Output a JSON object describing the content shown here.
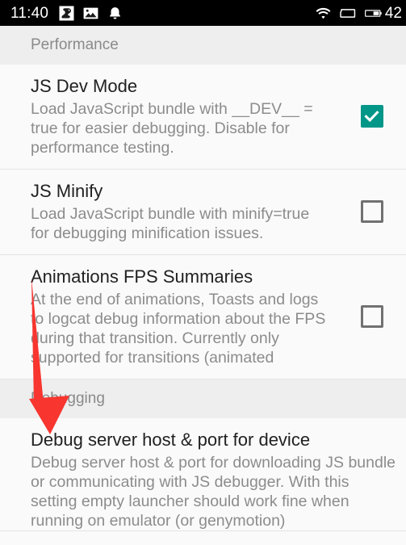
{
  "status_bar": {
    "time": "11:40",
    "battery_percent": "42",
    "left_icons": [
      "app-squirrel-icon",
      "screenshot-image-icon",
      "notification-bell-icon"
    ],
    "right_icons": [
      "wifi-icon",
      "sim-card-icon",
      "battery-icon"
    ],
    "background_color": "#000000",
    "text_color": "#ffffff"
  },
  "colors": {
    "accent_checked": "#009688",
    "section_header_bg": "#eeeeee",
    "page_bg": "#fafafa",
    "title_text": "#212121",
    "summary_text": "#8c8c8c",
    "divider": "#e4e4e4",
    "annotation_arrow": "#f8352f"
  },
  "sections": [
    {
      "header": "Performance",
      "rows": [
        {
          "title": "JS Dev Mode",
          "summary": "Load JavaScript bundle with __DEV__ = true for easier debugging.  Disable for performance testing.",
          "control": "checkbox",
          "checked": true
        },
        {
          "title": "JS Minify",
          "summary": "Load JavaScript bundle with minify=true for debugging minification issues.",
          "control": "checkbox",
          "checked": false
        },
        {
          "title": "Animations FPS Summaries",
          "summary": "At the end of animations, Toasts and logs to logcat debug information about the FPS during that transition. Currently only supported for transitions (animated",
          "control": "checkbox",
          "checked": false
        }
      ]
    },
    {
      "header": "Debugging",
      "rows": [
        {
          "title": "Debug server host & port for device",
          "summary": "Debug server host & port for downloading JS bundle or communicating with JS debugger. With this setting empty launcher should work fine when running on emulator (or genymotion)",
          "control": "none",
          "checked": false
        }
      ]
    }
  ],
  "annotation": {
    "type": "arrow",
    "points_to": "Debug server host & port for device"
  }
}
